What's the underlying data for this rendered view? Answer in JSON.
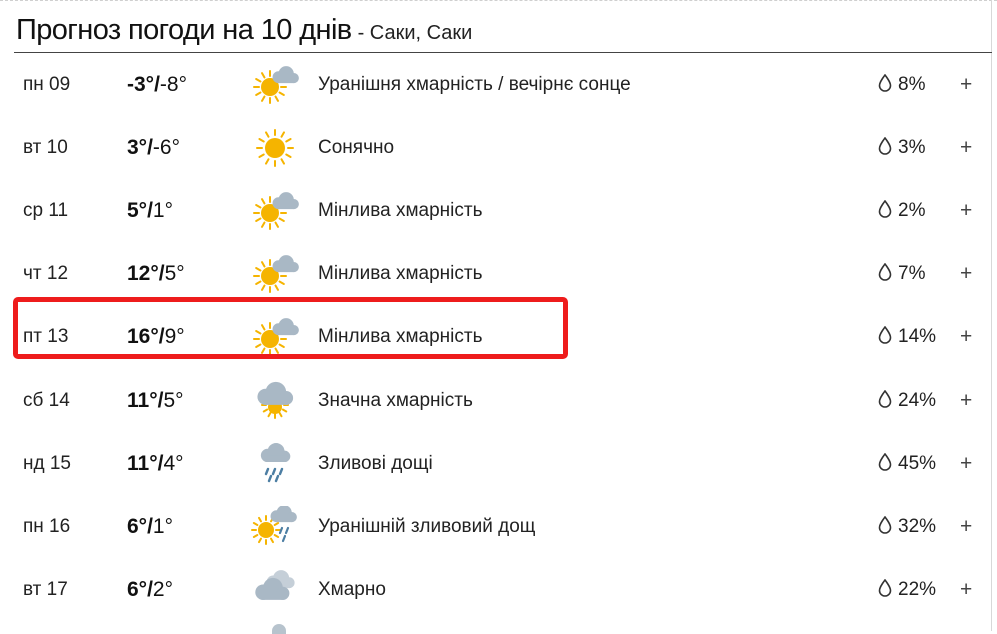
{
  "header": {
    "title": "Прогноз погоди на 10 днів",
    "subtitle": "- Саки, Саки"
  },
  "colors": {
    "sun": "#f5b400",
    "cloud": "#a9b8c5",
    "rain": "#4c7ea3",
    "highlight": "#ee1c1c"
  },
  "days": [
    {
      "date": "пн 09",
      "high": "-3°",
      "low": "-8°",
      "icon": "sun-cloud-icon",
      "desc": "Уранішня хмарність / вечірнє сонце",
      "precip": "8%"
    },
    {
      "date": "вт 10",
      "high": "3°",
      "low": "-6°",
      "icon": "sun-icon",
      "desc": "Сонячно",
      "precip": "3%"
    },
    {
      "date": "ср 11",
      "high": "5°",
      "low": "1°",
      "icon": "sun-cloud-icon",
      "desc": "Мінлива хмарність",
      "precip": "2%"
    },
    {
      "date": "чт 12",
      "high": "12°",
      "low": "5°",
      "icon": "sun-cloud-icon",
      "desc": "Мінлива хмарність",
      "precip": "7%"
    },
    {
      "date": "пт 13",
      "high": "16°",
      "low": "9°",
      "icon": "sun-cloud-icon",
      "desc": "Мінлива хмарність",
      "precip": "14%"
    },
    {
      "date": "сб 14",
      "high": "11°",
      "low": "5°",
      "icon": "cloud-sun-below-icon",
      "desc": "Значна хмарність",
      "precip": "24%"
    },
    {
      "date": "нд 15",
      "high": "11°",
      "low": "4°",
      "icon": "rain-cloud-icon",
      "desc": "Зливові дощі",
      "precip": "45%"
    },
    {
      "date": "пн 16",
      "high": "6°",
      "low": "1°",
      "icon": "sun-rain-cloud-icon",
      "desc": "Уранішній зливовий дощ",
      "precip": "32%"
    },
    {
      "date": "вт 17",
      "high": "6°",
      "low": "2°",
      "icon": "clouds-icon",
      "desc": "Хмарно",
      "precip": "22%"
    }
  ],
  "expand_label": "+"
}
